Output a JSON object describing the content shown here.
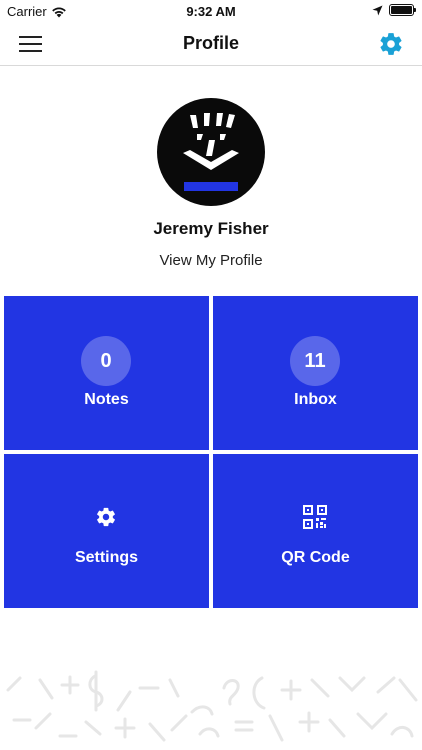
{
  "status_bar": {
    "carrier": "Carrier",
    "time": "9:32 AM"
  },
  "nav": {
    "title": "Profile",
    "menu_icon": "hamburger-menu-icon",
    "settings_icon": "gear-icon",
    "accent_color": "#1aa1d6"
  },
  "profile": {
    "name": "Jeremy Fisher",
    "view_profile_label": "View My Profile"
  },
  "tiles": [
    {
      "label": "Notes",
      "count": "0"
    },
    {
      "label": "Inbox",
      "count": "11"
    },
    {
      "label": "Settings",
      "icon": "gear-icon"
    },
    {
      "label": "QR Code",
      "icon": "qr-code-icon"
    }
  ],
  "colors": {
    "tile_background": "#2235e3",
    "tile_text": "#ffffff"
  }
}
